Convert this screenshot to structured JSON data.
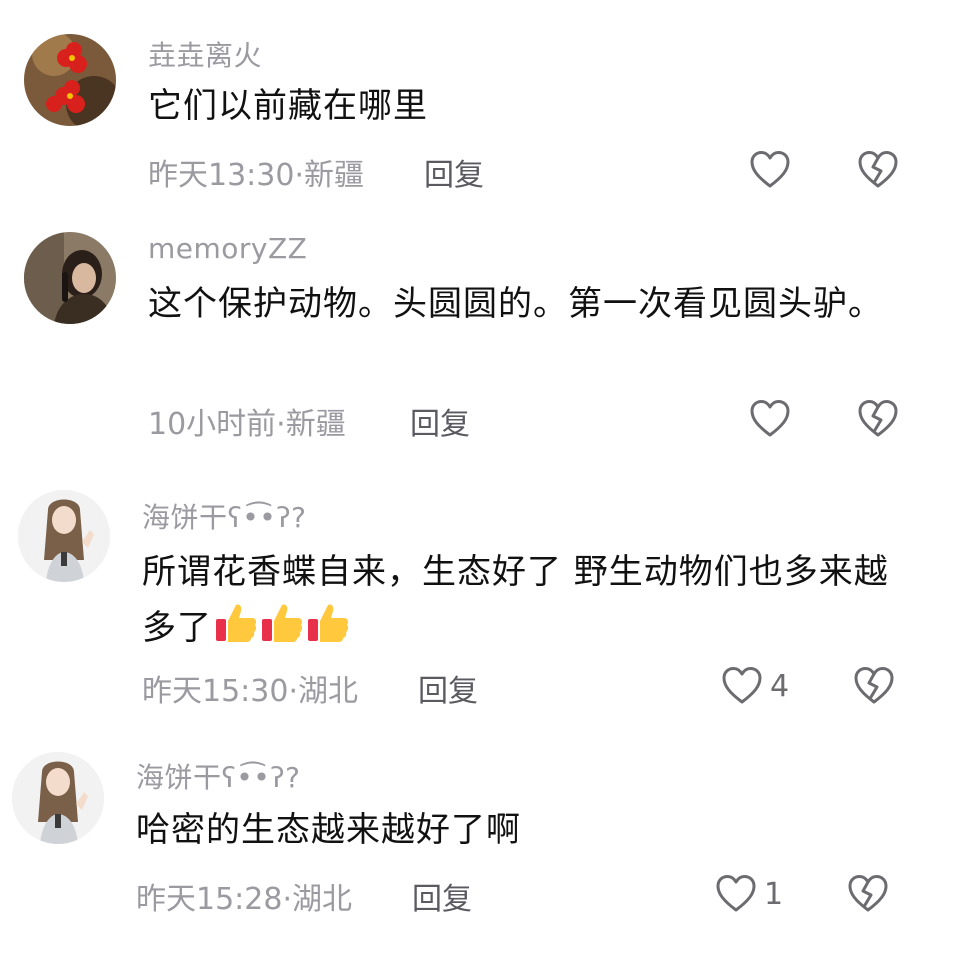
{
  "comments": [
    {
      "username": "垚垚离火",
      "text": "它们以前藏在哪里",
      "meta": "昨天13:30·新疆",
      "reply": "回复",
      "likes": "",
      "avatar": "red-flower-avatar"
    },
    {
      "username": "memoryZZ",
      "text": "这个保护动物。头圆圆的。第一次看见圆头驴。",
      "meta": "10小时前·新疆",
      "reply": "回复",
      "likes": "",
      "avatar": "girl-photo-avatar"
    },
    {
      "username": "海饼干ʕ•͡•ʔ?",
      "text": "所谓花香蝶自来，生态好了 野生动物们也多来越多了",
      "emoji": [
        "thumbs-up-icon",
        "thumbs-up-icon",
        "thumbs-up-icon"
      ],
      "meta": "昨天15:30·湖北",
      "reply": "回复",
      "likes": "4",
      "avatar": "anime-girl-avatar"
    },
    {
      "username": "海饼干ʕ•͡•ʔ?",
      "text": "哈密的生态越来越好了啊",
      "meta": "昨天15:28·湖北",
      "reply": "回复",
      "likes": "1",
      "avatar": "anime-girl-avatar"
    }
  ],
  "colors": {
    "username": "#9a9aa0",
    "text": "#111111",
    "meta": "#9a9aa0",
    "icon_stroke": "#6b6b70"
  }
}
